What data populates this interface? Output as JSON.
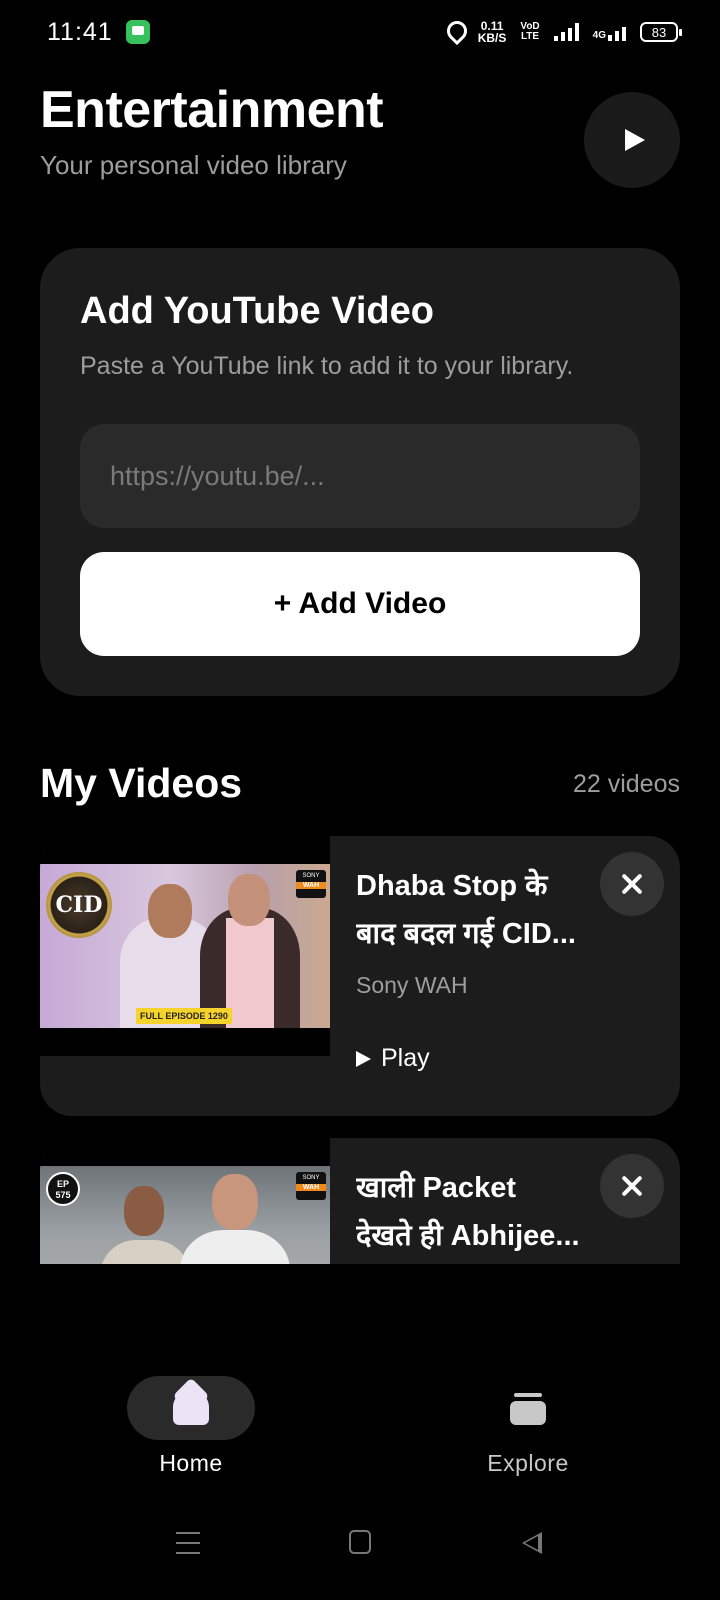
{
  "status_bar": {
    "time": "11:41",
    "net_speed_value": "0.11",
    "net_speed_unit": "KB/S",
    "volte_top": "VoD",
    "volte_bottom": "LTE",
    "network_type": "4G",
    "battery": "83"
  },
  "header": {
    "title": "Entertainment",
    "subtitle": "Your personal video library"
  },
  "add_card": {
    "title": "Add YouTube Video",
    "description": "Paste a YouTube link to add it to your library.",
    "url_placeholder": "https://youtu.be/...",
    "url_value": "",
    "add_button_label": "+ Add Video"
  },
  "my_videos": {
    "title": "My Videos",
    "count_label": "22 videos",
    "items": [
      {
        "title_line1": "Dhaba Stop के",
        "title_line2": "बाद बदल गई CID...",
        "channel": "Sony WAH",
        "play_label": "Play",
        "thumb_logo": "CID",
        "thumb_badge_top": "SONY",
        "thumb_badge_bottom": "WAH",
        "thumb_strip": "FULL EPISODE 1290"
      },
      {
        "title_line1": "खाली Packet",
        "title_line2": "देखते ही Abhijee...",
        "thumb_ep_top": "EP",
        "thumb_ep_bottom": "575",
        "thumb_badge_top": "SONY",
        "thumb_badge_bottom": "WAH"
      }
    ]
  },
  "bottom_nav": {
    "home_label": "Home",
    "explore_label": "Explore",
    "active": "Home"
  },
  "colors": {
    "background": "#000000",
    "card": "#1c1c1c",
    "input": "#2a2a2a",
    "muted_text": "#9d9d9d",
    "primary_button": "#ffffff"
  }
}
